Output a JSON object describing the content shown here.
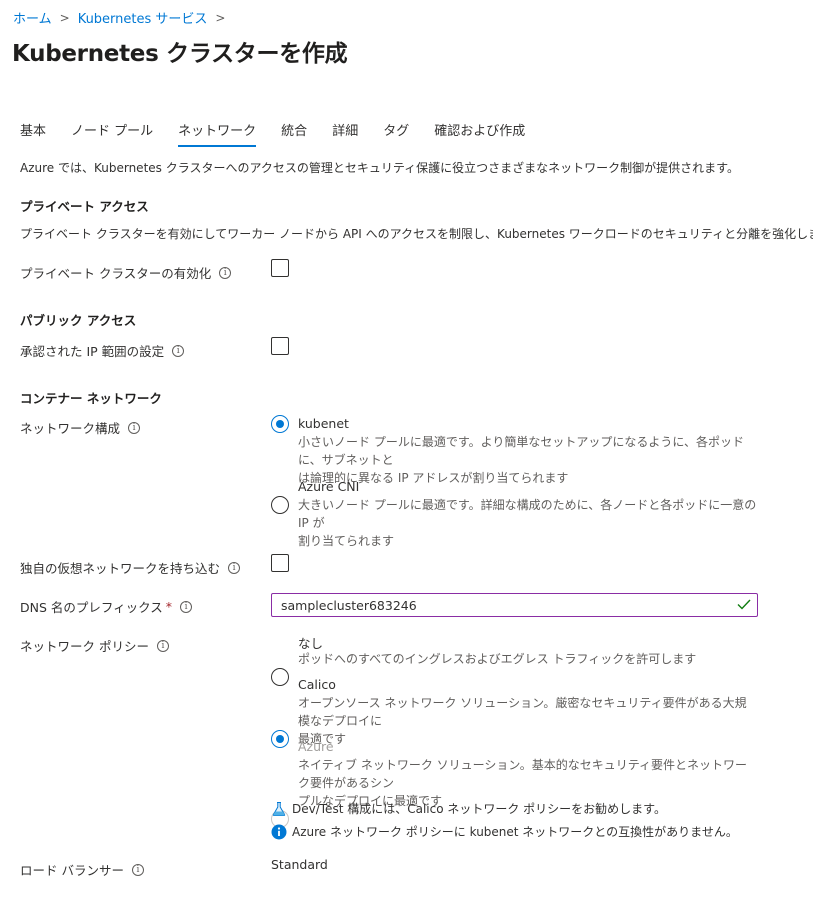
{
  "breadcrumb": {
    "items": [
      "ホーム",
      "Kubernetes サービス"
    ],
    "separator": ">"
  },
  "page": {
    "title": "Kubernetes クラスターを作成",
    "more_label": "…"
  },
  "tabs": [
    {
      "label": "基本",
      "active": false
    },
    {
      "label": "ノード プール",
      "active": false
    },
    {
      "label": "ネットワーク",
      "active": true
    },
    {
      "label": "統合",
      "active": false
    },
    {
      "label": "詳細",
      "active": false
    },
    {
      "label": "タグ",
      "active": false
    },
    {
      "label": "確認および作成",
      "active": false
    }
  ],
  "intro": "Azure では、Kubernetes クラスターへのアクセスの管理とセキュリティ保護に役立つさまざまなネットワーク制御が提供されます。",
  "private_access": {
    "heading": "プライベート アクセス",
    "description": "プライベート クラスターを有効にしてワーカー ノードから API へのアクセスを制限し、Kubernetes ワークロードのセキュリティと分離を強化します。",
    "enable_label": "プライベート クラスターの有効化",
    "enabled": false
  },
  "public_access": {
    "heading": "パブリック アクセス",
    "ip_ranges_label": "承認された IP 範囲の設定",
    "ip_ranges_enabled": false
  },
  "container_network": {
    "heading": "コンテナー ネットワーク",
    "network_config_label": "ネットワーク構成",
    "network_options": [
      {
        "title": "kubenet",
        "desc_line1": "小さいノード プールに最適です。より簡単なセットアップになるように、各ポッドに、サブネットと",
        "desc_line2": "は論理的に異なる IP アドレスが割り当てられます",
        "selected": true
      },
      {
        "title": "Azure CNI",
        "desc_line1": "大きいノード プールに最適です。詳細な構成のために、各ノードと各ポッドに一意の IP が",
        "desc_line2": "割り当てられます",
        "selected": false
      }
    ],
    "byo_vnet_label": "独自の仮想ネットワークを持ち込む",
    "byo_vnet_enabled": false,
    "dns_prefix_label": "DNS 名のプレフィックス",
    "dns_prefix_required": "*",
    "dns_prefix_value": "samplecluster683246",
    "network_policy_label": "ネットワーク ポリシー",
    "policy_options": [
      {
        "title": "なし",
        "desc_line1": "ポッドへのすべてのイングレスおよびエグレス トラフィックを許可します",
        "desc_line2": "",
        "selected": false,
        "disabled": false
      },
      {
        "title": "Calico",
        "desc_line1": "オープンソース ネットワーク ソリューション。厳密なセキュリティ要件がある大規模なデプロイに",
        "desc_line2": "最適です",
        "selected": true,
        "disabled": false
      },
      {
        "title": "Azure",
        "desc_line1": "ネイティブ ネットワーク ソリューション。基本的なセキュリティ要件とネットワーク要件があるシン",
        "desc_line2": "プルなデプロイに最適です",
        "selected": false,
        "disabled": true
      }
    ],
    "devtest_note": "Dev/Test 構成には、Calico ネットワーク ポリシーをお勧めします。",
    "compat_note": "Azure ネットワーク ポリシーに kubenet ネットワークとの互換性がありません。",
    "load_balancer_label": "ロード バランサー",
    "load_balancer_value": "Standard"
  },
  "icons": {
    "info": "info-icon",
    "flask": "flask-icon",
    "info_filled": "info-filled-icon",
    "valid": "checkmark-icon",
    "chevron": "chevron-right-icon"
  },
  "colors": {
    "accent": "#0078d4",
    "input_border": "#8a2da5",
    "valid_check": "#107c10"
  }
}
